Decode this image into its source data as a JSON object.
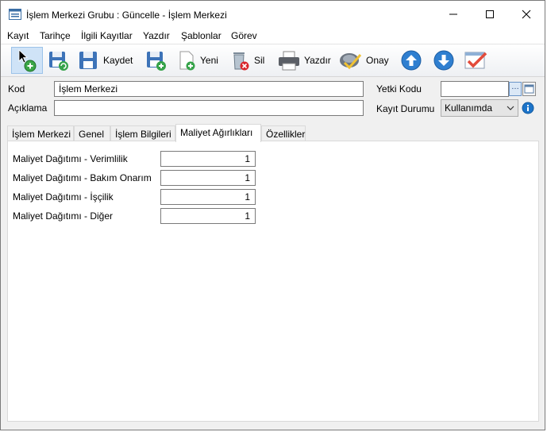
{
  "window": {
    "title": "İşlem Merkezi Grubu : Güncelle - İşlem Merkezi"
  },
  "menu": {
    "items": [
      "Kayıt",
      "Tarihçe",
      "İlgili Kayıtlar",
      "Yazdır",
      "Şablonlar",
      "Görev"
    ]
  },
  "toolbar": {
    "save_label": "Kaydet",
    "new_label": "Yeni",
    "delete_label": "Sil",
    "print_label": "Yazdır",
    "approve_label": "Onay"
  },
  "form": {
    "kod_label": "Kod",
    "kod_value": "İşlem Merkezi",
    "aciklama_label": "Açıklama",
    "aciklama_value": "",
    "yetki_label": "Yetki Kodu",
    "yetki_value": "",
    "kayit_durumu_label": "Kayıt Durumu",
    "kayit_durumu_value": "Kullanımda"
  },
  "tabs": [
    "İşlem Merkezi",
    "Genel",
    "İşlem Bilgileri",
    "Maliyet Ağırlıkları",
    "Özellikler"
  ],
  "active_tab": "Maliyet Ağırlıkları",
  "panel": {
    "rows": [
      {
        "label": "Maliyet Dağıtımı - Verimlilik",
        "value": "1"
      },
      {
        "label": "Maliyet Dağıtımı - Bakım Onarım",
        "value": "1"
      },
      {
        "label": "Maliyet Dağıtımı - İşçilik",
        "value": "1"
      },
      {
        "label": "Maliyet Dağıtımı - Diğer",
        "value": "1"
      }
    ]
  },
  "colors": {
    "accent": "#1c74c9",
    "active_toolbar_bg": "#cfe3f7",
    "delete_red": "#d9262c",
    "approve_red": "#e24b3b"
  },
  "icons": {
    "app": "window-form-icon",
    "new_record": "cursor-add-icon",
    "save_refresh": "save-refresh-icon",
    "save": "floppy-disk-icon",
    "new": "floppy-add-icon",
    "new_doc": "document-add-icon",
    "delete": "trash-delete-icon",
    "print": "printer-icon",
    "approve": "approve-key-icon",
    "up": "arrow-up-icon",
    "down": "arrow-down-icon",
    "checklist": "checklist-icon",
    "info": "info-icon"
  }
}
